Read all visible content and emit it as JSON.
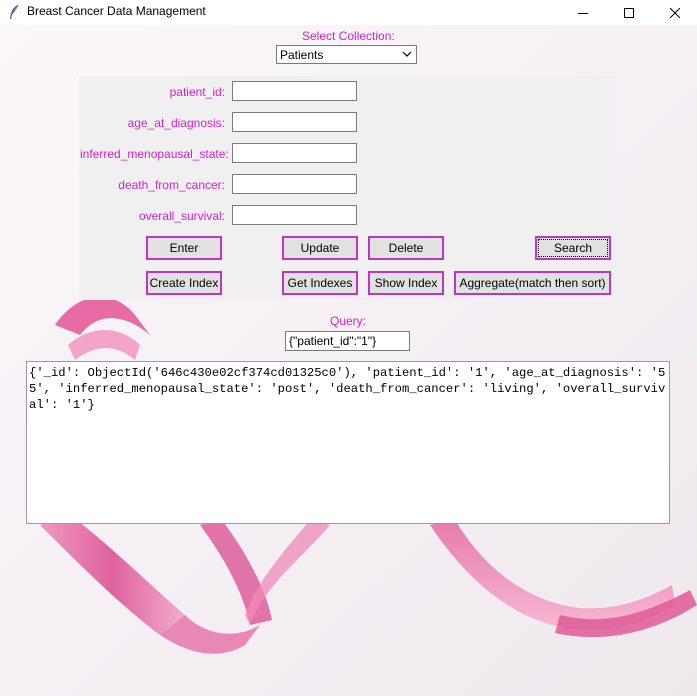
{
  "window": {
    "title": "Breast Cancer Data Management",
    "icon": "feather-icon",
    "controls": [
      "minimize-icon",
      "maximize-icon",
      "close-icon"
    ]
  },
  "collection": {
    "label": "Select Collection:",
    "selected": "Patients"
  },
  "fields": [
    {
      "label": "patient_id:",
      "value": ""
    },
    {
      "label": "age_at_diagnosis:",
      "value": ""
    },
    {
      "label": "inferred_menopausal_state:",
      "value": ""
    },
    {
      "label": "death_from_cancer:",
      "value": ""
    },
    {
      "label": "overall_survival:",
      "value": ""
    }
  ],
  "buttons": {
    "enter": "Enter",
    "update": "Update",
    "delete": "Delete",
    "search": "Search",
    "create_index": "Create Index",
    "get_indexes": "Get Indexes",
    "show_index": "Show Index",
    "aggregate": "Aggregate(match then sort)"
  },
  "query": {
    "label": "Query:",
    "value": "{\"patient_id\":\"1\"}"
  },
  "result_text": "{'_id': ObjectId('646c430e02cf374cd01325c0'), 'patient_id': '1', 'age_at_diagnosis': '55', 'inferred_menopausal_state': 'post', 'death_from_cancer': 'living', 'overall_survival': '1'}",
  "colors": {
    "label": "#d41fd4",
    "button_border": "#c035c0",
    "ribbon": "#e0609a"
  }
}
